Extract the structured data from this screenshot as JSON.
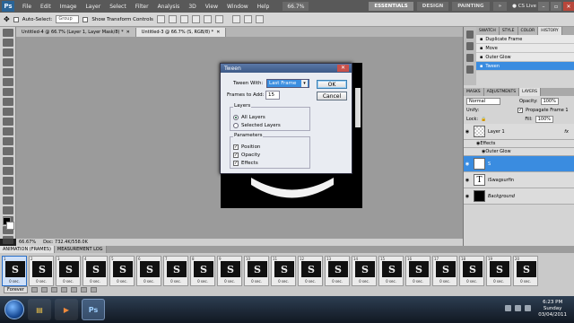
{
  "menubar": {
    "logo": "Ps",
    "menus": [
      "File",
      "Edit",
      "Image",
      "Layer",
      "Select",
      "Filter",
      "Analysis",
      "3D",
      "View",
      "Window",
      "Help"
    ],
    "zoom": "66.7%",
    "workspaces": [
      "ESSENTIALS",
      "DESIGN",
      "PAINTING"
    ],
    "active_workspace": "ESSENTIALS",
    "more": "»",
    "cs_live": "CS Live"
  },
  "options": {
    "auto_select_label": "Auto-Select:",
    "auto_select_value": "Group",
    "show_transform_label": "Show Transform Controls"
  },
  "tabs": [
    {
      "label": "Untitled-4 @ 66.7% (Layer 1, Layer Mask/8) *",
      "active": false
    },
    {
      "label": "Untitled-3 @ 66.7% (S, RGB/8) *",
      "active": true
    }
  ],
  "status": {
    "zoom": "66.67%",
    "doc": "Doc: 732.4K/558.0K"
  },
  "dialog": {
    "title": "Tween",
    "tween_with_label": "Tween With:",
    "tween_with_value": "Last Frame",
    "frames_to_add_label": "Frames to Add:",
    "frames_to_add_value": "15",
    "ok": "OK",
    "cancel": "Cancel",
    "layers_title": "Layers",
    "layers_options": [
      "All Layers",
      "Selected Layers"
    ],
    "params_title": "Parameters",
    "params": [
      "Position",
      "Opacity",
      "Effects"
    ]
  },
  "history_panel": {
    "tabs": [
      "SWATCH",
      "STYLE",
      "COLOR",
      "HISTORY"
    ],
    "items": [
      "Duplicate Frame",
      "Move",
      "Outer Glow",
      "Tween"
    ],
    "selected": "Tween"
  },
  "layers_panel": {
    "tabs": [
      "MASKS",
      "ADJUSTMENTS",
      "LAYERS"
    ],
    "blend_mode": "Normal",
    "opacity_label": "Opacity:",
    "opacity_value": "100%",
    "unify_label": "Unify:",
    "propagate_label": "Propagate Frame 1",
    "lock_label": "Lock:",
    "fill_label": "Fill:",
    "fill_value": "100%",
    "layers": [
      {
        "name": "Layer 1",
        "thumb": "",
        "selected": false
      },
      {
        "name": "S",
        "thumb": "T",
        "selected": true
      },
      {
        "name": "iSwagsurfin",
        "thumb": "T",
        "selected": false
      },
      {
        "name": "Background",
        "thumb": "",
        "selected": false
      }
    ],
    "effects_label": "Effects",
    "outer_glow_label": "Outer Glow",
    "fx": "fx"
  },
  "timeline": {
    "tabs": [
      "ANIMATION (FRAMES)",
      "MEASUREMENT LOG"
    ],
    "frames": [
      {
        "num": "1",
        "delay": "0 sec."
      },
      {
        "num": "2",
        "delay": "0 sec."
      },
      {
        "num": "3",
        "delay": "0 sec."
      },
      {
        "num": "4",
        "delay": "0 sec."
      },
      {
        "num": "5",
        "delay": "0 sec."
      },
      {
        "num": "6",
        "delay": "0 sec."
      },
      {
        "num": "7",
        "delay": "0 sec."
      },
      {
        "num": "8",
        "delay": "0 sec."
      },
      {
        "num": "9",
        "delay": "0 sec."
      },
      {
        "num": "10",
        "delay": "0 sec."
      },
      {
        "num": "11",
        "delay": "0 sec."
      },
      {
        "num": "12",
        "delay": "0 sec."
      },
      {
        "num": "13",
        "delay": "0 sec."
      },
      {
        "num": "14",
        "delay": "0 sec."
      },
      {
        "num": "15",
        "delay": "0 sec."
      },
      {
        "num": "16",
        "delay": "0 sec."
      },
      {
        "num": "17",
        "delay": "0 sec."
      },
      {
        "num": "18",
        "delay": "0 sec."
      },
      {
        "num": "19",
        "delay": "0 sec."
      },
      {
        "num": "20",
        "delay": "0 sec."
      }
    ],
    "frame_glyph": "S",
    "loop": "Forever"
  },
  "taskbar": {
    "apps": [
      "Ps"
    ],
    "time": "6:23 PM",
    "day": "Sunday",
    "date": "03/04/2011"
  }
}
